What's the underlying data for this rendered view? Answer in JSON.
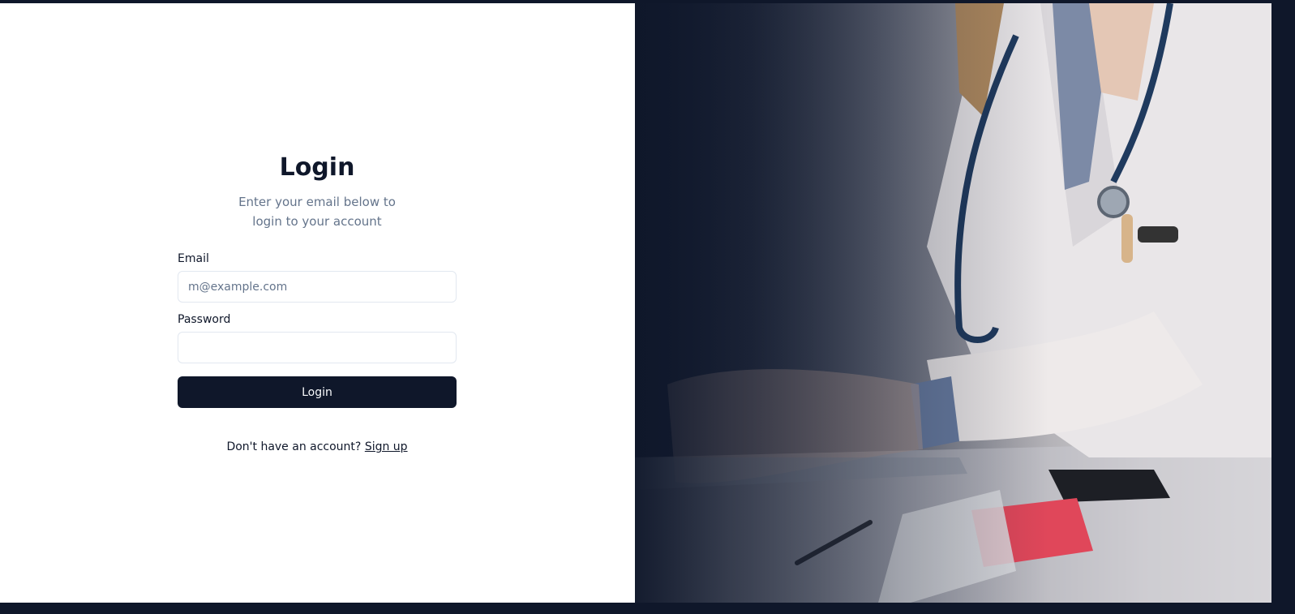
{
  "login": {
    "title": "Login",
    "subtitle": "Enter your email below to login to your account",
    "email_label": "Email",
    "email_placeholder": "m@example.com",
    "email_value": "",
    "password_label": "Password",
    "password_value": "",
    "submit_label": "Login",
    "signup_prompt": "Don't have an account?",
    "signup_link": "Sign up"
  },
  "hero_image": {
    "icon": "doctor-at-laptop-photo"
  },
  "colors": {
    "primary": "#0f172a",
    "muted_text": "#64748b",
    "border": "#e2e8f0",
    "background": "#ffffff"
  }
}
